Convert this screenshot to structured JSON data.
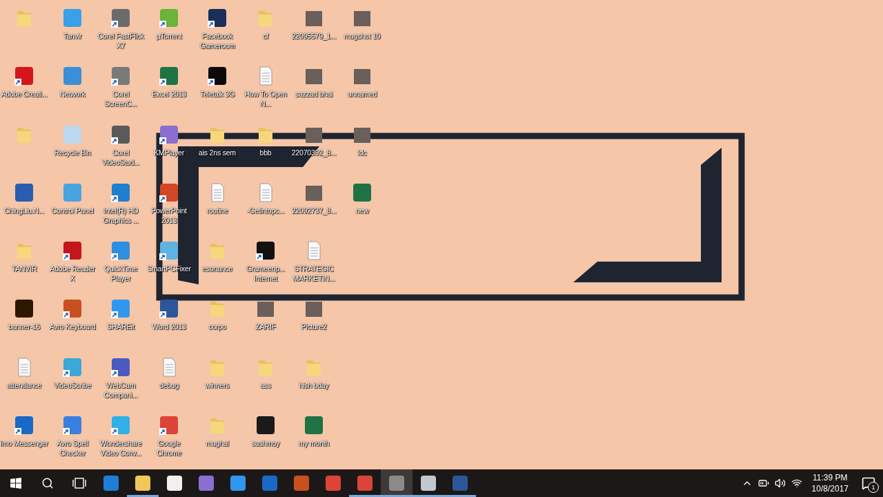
{
  "icon_rows": [
    [
      {
        "kind": "folder",
        "shortcut": false
      },
      {
        "label": "Tanvir",
        "kind": "app",
        "color": "#3aa0e8",
        "shortcut": false
      },
      {
        "label": "Corel FastFlick X7",
        "kind": "app",
        "color": "#6b6b6b",
        "shortcut": true
      },
      {
        "label": "µTorrent",
        "kind": "app",
        "color": "#6bb33a",
        "shortcut": true
      },
      {
        "label": "Facebook Gameroom",
        "kind": "app",
        "color": "#1a2f5a",
        "shortcut": true
      },
      {
        "label": "cf",
        "kind": "folder",
        "shortcut": false
      },
      {
        "label": "22095579_1...",
        "kind": "photo",
        "shortcut": false
      },
      {
        "label": "mugshot  10",
        "kind": "photo",
        "shortcut": false
      }
    ],
    [
      {
        "label": "Adobe Creati...",
        "kind": "app",
        "color": "#d4161c",
        "shortcut": true
      },
      {
        "label": "Network",
        "kind": "app",
        "color": "#3a8fd8",
        "shortcut": false
      },
      {
        "label": "Corel ScreenC...",
        "kind": "app",
        "color": "#7a7a7a",
        "shortcut": true
      },
      {
        "label": "Excel 2013",
        "kind": "app",
        "color": "#1f7244",
        "shortcut": true
      },
      {
        "label": "Teletalk 3G",
        "kind": "app",
        "color": "#0a0a0a",
        "shortcut": true
      },
      {
        "label": "How To Open N...",
        "kind": "document",
        "shortcut": false
      },
      {
        "label": "sazzad bhai",
        "kind": "photo",
        "shortcut": false
      },
      {
        "label": "unnamed",
        "kind": "photo",
        "shortcut": false
      }
    ],
    [
      {
        "kind": "folder",
        "shortcut": false
      },
      {
        "label": "Recycle Bin",
        "kind": "app",
        "color": "#bcd8ee",
        "shortcut": false
      },
      {
        "label": "Corel VideoStud...",
        "kind": "app",
        "color": "#5a5a5a",
        "shortcut": true
      },
      {
        "label": "KMPlayer",
        "kind": "app",
        "color": "#8a6fd0",
        "shortcut": true
      },
      {
        "label": "ais 2ns sem",
        "kind": "folder",
        "shortcut": false
      },
      {
        "label": "bbb",
        "kind": "folder",
        "shortcut": false
      },
      {
        "label": "22070392_8...",
        "kind": "photo",
        "shortcut": false
      },
      {
        "label": "ldc",
        "kind": "photo",
        "shortcut": false
      }
    ],
    [
      {
        "label": "ChingLiu.N...",
        "kind": "app",
        "color": "#2a5db0",
        "shortcut": false
      },
      {
        "label": "Control Panel",
        "kind": "app",
        "color": "#4aa3df",
        "shortcut": false
      },
      {
        "label": "Intel(R) HD Graphics ...",
        "kind": "app",
        "color": "#1e7fd0",
        "shortcut": true
      },
      {
        "label": "PowerPoint 2013",
        "kind": "app",
        "color": "#d24726",
        "shortcut": true
      },
      {
        "label": "routine",
        "kind": "document",
        "shortcut": false
      },
      {
        "label": "-Getintopc...",
        "kind": "document",
        "shortcut": false
      },
      {
        "label": "22092737_8...",
        "kind": "photo",
        "shortcut": false
      },
      {
        "label": "new",
        "kind": "app",
        "color": "#1f7244",
        "shortcut": false
      }
    ],
    [
      {
        "label": "TANVIR",
        "kind": "folder",
        "shortcut": false
      },
      {
        "label": "Adobe Reader X",
        "kind": "app",
        "color": "#c5161d",
        "shortcut": true
      },
      {
        "label": "QuickTime Player",
        "kind": "app",
        "color": "#2f8ee0",
        "shortcut": true
      },
      {
        "label": "SmartPCFixer",
        "kind": "app",
        "color": "#5fb3e0",
        "shortcut": true
      },
      {
        "label": "esonance",
        "kind": "folder",
        "shortcut": false
      },
      {
        "label": "Grameenp... Internet",
        "kind": "app",
        "color": "#111111",
        "shortcut": true
      },
      {
        "label": "STRATEGIC MARKETIN...",
        "kind": "document",
        "shortcut": false
      }
    ],
    [
      {
        "label": "banner-16",
        "kind": "app",
        "color": "#2e1600",
        "shortcut": false
      },
      {
        "label": "Avro Keyboard",
        "kind": "app",
        "color": "#c8501e",
        "shortcut": true
      },
      {
        "label": "SHAREit",
        "kind": "app",
        "color": "#2f97ef",
        "shortcut": true
      },
      {
        "label": "Word 2013",
        "kind": "app",
        "color": "#2b579a",
        "shortcut": true
      },
      {
        "label": "corpo",
        "kind": "folder",
        "shortcut": false
      },
      {
        "label": "ZARIF",
        "kind": "photo",
        "shortcut": false
      },
      {
        "label": "Picture2",
        "kind": "photo",
        "shortcut": false
      }
    ],
    [
      {
        "label": "attendance",
        "kind": "document",
        "shortcut": false
      },
      {
        "label": "VideoScribe",
        "kind": "app",
        "color": "#3aa8d8",
        "shortcut": true
      },
      {
        "label": "WebCam Compani...",
        "kind": "app",
        "color": "#4a5ac0",
        "shortcut": true
      },
      {
        "label": "debug",
        "kind": "document",
        "shortcut": false
      },
      {
        "label": "winners",
        "kind": "folder",
        "shortcut": false
      },
      {
        "label": "ass",
        "kind": "folder",
        "shortcut": false
      },
      {
        "label": "hish bday",
        "kind": "folder",
        "shortcut": false
      }
    ],
    [
      {
        "label": "Imo Messenger",
        "kind": "app",
        "color": "#1a68c8",
        "shortcut": true
      },
      {
        "label": "Avro Spell Checker",
        "kind": "app",
        "color": "#3a7fe0",
        "shortcut": true
      },
      {
        "label": "Wondershare Video Conv...",
        "kind": "app",
        "color": "#2fb0e8",
        "shortcut": true
      },
      {
        "label": "Google Chrome",
        "kind": "app",
        "color": "#db4437",
        "shortcut": true
      },
      {
        "label": "mughal",
        "kind": "folder",
        "shortcut": false
      },
      {
        "label": "sushmoy",
        "kind": "app",
        "color": "#1a1a1a",
        "shortcut": false
      },
      {
        "label": "my month",
        "kind": "app",
        "color": "#1f7244",
        "shortcut": false
      }
    ]
  ],
  "taskbar": {
    "apps": [
      {
        "color": "#1e7fd8",
        "running": false,
        "highlighted": false
      },
      {
        "color": "#f1c75a",
        "running": true,
        "highlighted": false
      },
      {
        "color": "#f0f0f0",
        "running": false,
        "highlighted": false
      },
      {
        "color": "#8a6fd0",
        "running": false,
        "highlighted": false
      },
      {
        "color": "#2f97ef",
        "running": false,
        "highlighted": false
      },
      {
        "color": "#1a68c8",
        "running": false,
        "highlighted": false
      },
      {
        "color": "#c8501e",
        "running": false,
        "highlighted": false
      },
      {
        "color": "#db4437",
        "running": false,
        "highlighted": false
      },
      {
        "color": "#db4437",
        "running": true,
        "highlighted": false
      },
      {
        "color": "#8a8a8a",
        "running": true,
        "highlighted": true
      },
      {
        "color": "#c0c8d0",
        "running": true,
        "highlighted": false
      },
      {
        "color": "#2b579a",
        "running": true,
        "highlighted": false
      }
    ],
    "time": "11:39 PM",
    "date": "10/8/2017",
    "notification_count": "1"
  }
}
